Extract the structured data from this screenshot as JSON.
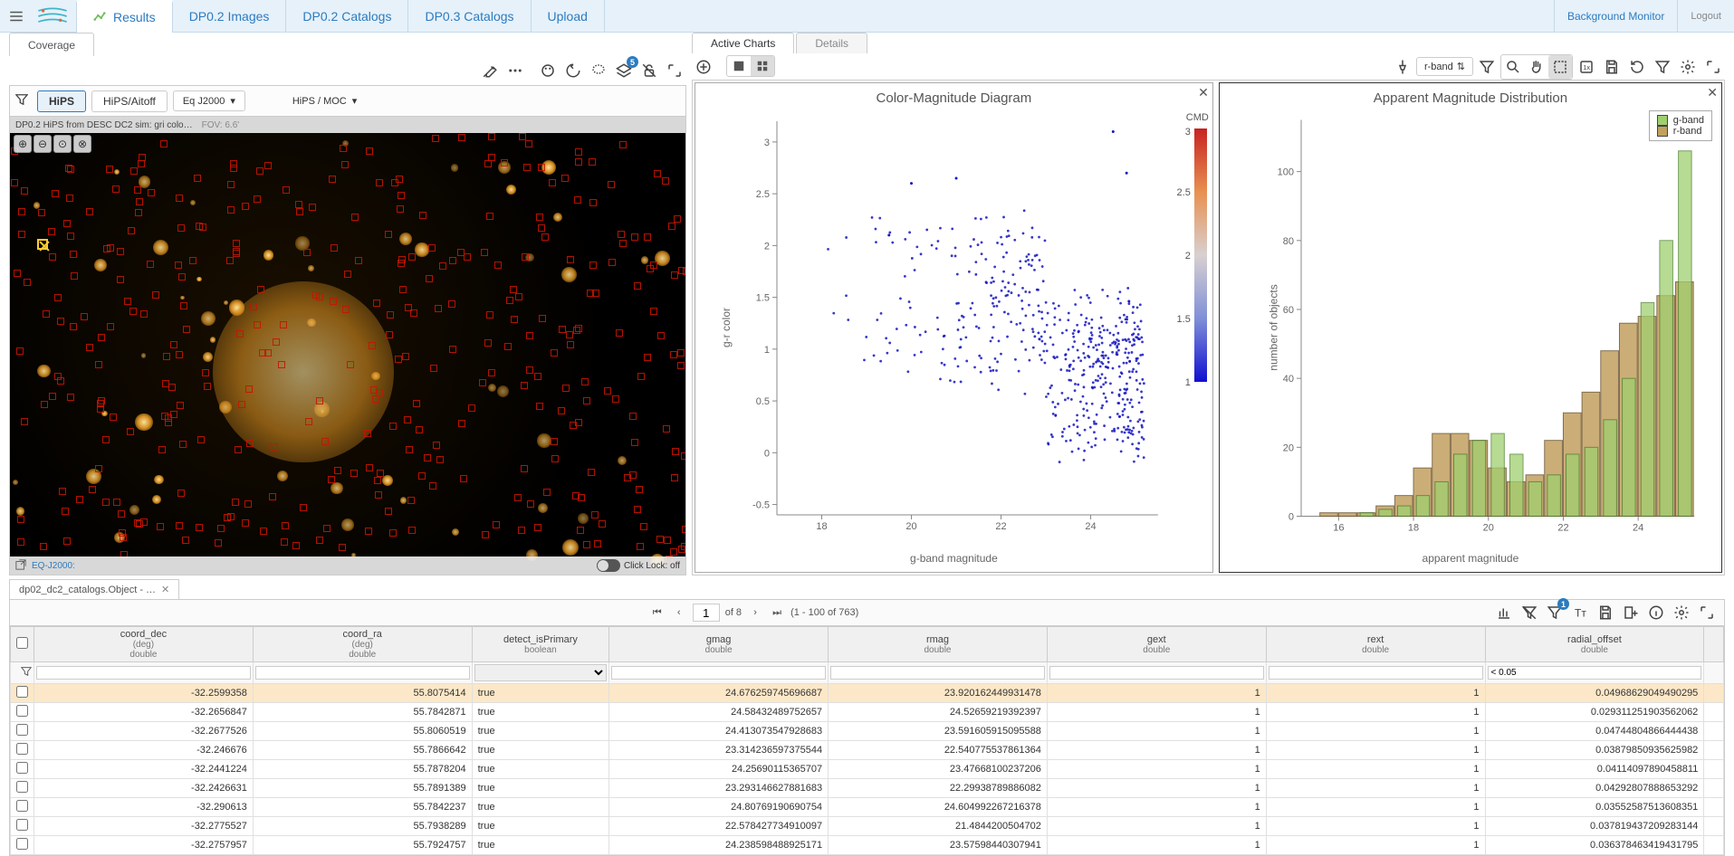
{
  "topnav": {
    "tabs": [
      "Results",
      "DP0.2 Images",
      "DP0.2 Catalogs",
      "DP0.3 Catalogs",
      "Upload"
    ],
    "active": 0,
    "background_monitor": "Background Monitor",
    "logout": "Logout"
  },
  "left": {
    "cov_tab": "Coverage",
    "toolbar_badge": "5",
    "pill_hips": "HiPS",
    "pill_aitoff": "HiPS/Aitoff",
    "proj_sel": "Eq J2000",
    "hips_moc": "HiPS / MOC",
    "info_line": "DP0.2 HiPS from DESC DC2 sim: gri colo…",
    "fov": "FOV: 6.6'",
    "footer_eq": "EQ-J2000:",
    "click_lock": "Click Lock: off"
  },
  "charts": {
    "tabs": [
      "Active Charts",
      "Details"
    ],
    "active": 0,
    "drop_sel": "r-band"
  },
  "chart_data": [
    {
      "type": "scatter",
      "title": "Color-Magnitude Diagram",
      "xlabel": "g-band magnitude",
      "ylabel": "g-r color",
      "xlim": [
        17,
        25.5
      ],
      "ylim": [
        -0.6,
        3.2
      ],
      "xticks": [
        18,
        20,
        22,
        24
      ],
      "yticks": [
        -0.5,
        0,
        0.5,
        1,
        1.5,
        2,
        2.5,
        3
      ],
      "colorbar": {
        "label": "CMD",
        "min": 1,
        "max": 3,
        "ticks": [
          1,
          1.5,
          2,
          2.5,
          3
        ]
      },
      "points_seed": 763
    },
    {
      "type": "histogram",
      "title": "Apparent Magnitude Distribution",
      "xlabel": "apparent magnitude",
      "ylabel": "number of objects",
      "xlim": [
        15,
        25.5
      ],
      "ylim": [
        0,
        115
      ],
      "xticks": [
        16,
        18,
        20,
        22,
        24
      ],
      "yticks": [
        0,
        20,
        40,
        60,
        80,
        100
      ],
      "series": [
        {
          "name": "g-band",
          "color": "#9fcf70",
          "border": "#4a7f2a",
          "bins": [
            15.5,
            16,
            16.5,
            17,
            17.5,
            18,
            18.5,
            19,
            19.5,
            20,
            20.5,
            21,
            21.5,
            22,
            22.5,
            23,
            23.5,
            24,
            24.5,
            25
          ],
          "counts": [
            0,
            0,
            1,
            2,
            3,
            6,
            10,
            18,
            22,
            24,
            18,
            10,
            12,
            18,
            20,
            28,
            40,
            62,
            80,
            106
          ]
        },
        {
          "name": "r-band",
          "color": "#c2a060",
          "border": "#6d5530",
          "bins": [
            15.5,
            16,
            16.5,
            17,
            17.5,
            18,
            18.5,
            19,
            19.5,
            20,
            20.5,
            21,
            21.5,
            22,
            22.5,
            23,
            23.5,
            24,
            24.5,
            25
          ],
          "counts": [
            1,
            1,
            1,
            3,
            6,
            14,
            24,
            24,
            22,
            14,
            10,
            12,
            22,
            30,
            36,
            48,
            56,
            58,
            64,
            68
          ]
        }
      ],
      "legend": [
        "g-band",
        "r-band"
      ]
    }
  ],
  "table": {
    "tab_name": "dp02_dc2_catalogs.Object - …",
    "page": "1",
    "of": "of 8",
    "range": "(1 - 100 of 763)",
    "filter_radial": "< 0.05",
    "columns": [
      {
        "name": "coord_dec",
        "unit": "(deg)",
        "type": "double"
      },
      {
        "name": "coord_ra",
        "unit": "(deg)",
        "type": "double"
      },
      {
        "name": "detect_isPrimary",
        "unit": "",
        "type": "boolean"
      },
      {
        "name": "gmag",
        "unit": "",
        "type": "double"
      },
      {
        "name": "rmag",
        "unit": "",
        "type": "double"
      },
      {
        "name": "gext",
        "unit": "",
        "type": "double"
      },
      {
        "name": "rext",
        "unit": "",
        "type": "double"
      },
      {
        "name": "radial_offset",
        "unit": "",
        "type": "double"
      }
    ],
    "rows": [
      {
        "coord_dec": "-32.2599358",
        "coord_ra": "55.8075414",
        "detect": "true",
        "gmag": "24.676259745696687",
        "rmag": "23.920162449931478",
        "gext": "1",
        "rext": "1",
        "ro": "0.04968629049490295"
      },
      {
        "coord_dec": "-32.2656847",
        "coord_ra": "55.7842871",
        "detect": "true",
        "gmag": "24.58432489752657",
        "rmag": "24.52659219392397",
        "gext": "1",
        "rext": "1",
        "ro": "0.029311251903562062"
      },
      {
        "coord_dec": "-32.2677526",
        "coord_ra": "55.8060519",
        "detect": "true",
        "gmag": "24.413073547928683",
        "rmag": "23.591605915095588",
        "gext": "1",
        "rext": "1",
        "ro": "0.04744804866444438"
      },
      {
        "coord_dec": "-32.246676",
        "coord_ra": "55.7866642",
        "detect": "true",
        "gmag": "23.314236597375544",
        "rmag": "22.540775537861364",
        "gext": "1",
        "rext": "1",
        "ro": "0.03879850935625982"
      },
      {
        "coord_dec": "-32.2441224",
        "coord_ra": "55.7878204",
        "detect": "true",
        "gmag": "24.25690115365707",
        "rmag": "23.47668100237206",
        "gext": "1",
        "rext": "1",
        "ro": "0.04114097890458811"
      },
      {
        "coord_dec": "-32.2426631",
        "coord_ra": "55.7891389",
        "detect": "true",
        "gmag": "23.293146627881683",
        "rmag": "22.29938789886082",
        "gext": "1",
        "rext": "1",
        "ro": "0.04292807888653292"
      },
      {
        "coord_dec": "-32.290613",
        "coord_ra": "55.7842237",
        "detect": "true",
        "gmag": "24.80769190690754",
        "rmag": "24.604992267216378",
        "gext": "1",
        "rext": "1",
        "ro": "0.03552587513608351"
      },
      {
        "coord_dec": "-32.2775527",
        "coord_ra": "55.7938289",
        "detect": "true",
        "gmag": "22.578427734910097",
        "rmag": "21.4844200504702",
        "gext": "1",
        "rext": "1",
        "ro": "0.037819437209283144"
      },
      {
        "coord_dec": "-32.2757957",
        "coord_ra": "55.7924757",
        "detect": "true",
        "gmag": "24.238598488925171",
        "rmag": "23.57598440307941",
        "gext": "1",
        "rext": "1",
        "ro": "0.036378463419431795"
      }
    ]
  }
}
